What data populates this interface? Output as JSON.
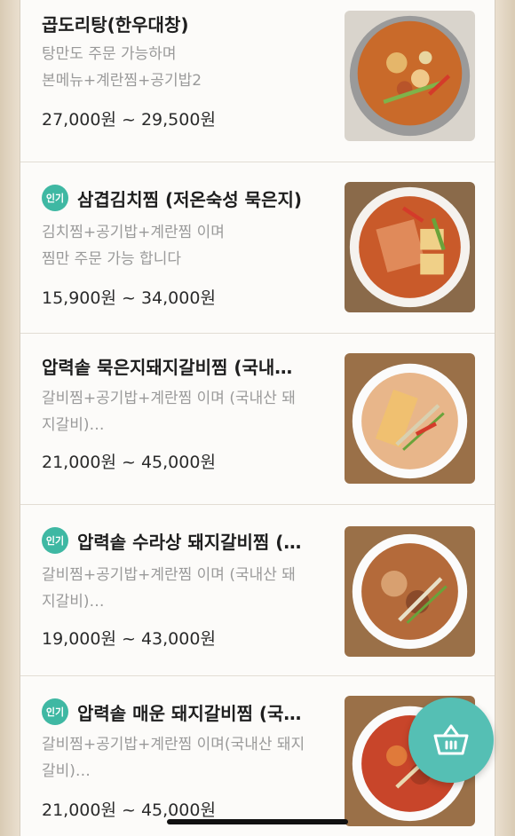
{
  "items": [
    {
      "title": "곱도리탕(한우대창)",
      "badge": "",
      "desc_line1": "탕만도 주문 가능하며",
      "desc_line2": "본메뉴+계란찜+공기밥2",
      "price": "27,000원 ~ 29,500원"
    },
    {
      "title": "삼겹김치찜 (저온숙성 묵은지)",
      "badge": "인기",
      "desc_line1": "김치찜+공기밥+계란찜 이며",
      "desc_line2": "찜만 주문 가능 합니다",
      "price": "15,900원 ~ 34,000원"
    },
    {
      "title": "압력솥 묵은지돼지갈비찜 (국내…",
      "badge": "",
      "desc_line1": "갈비찜+공기밥+계란찜 이며 (국내산 돼",
      "desc_line2": "지갈비)…",
      "price": "21,000원 ~ 45,000원"
    },
    {
      "title": "압력솥 수라상 돼지갈비찜 (…",
      "badge": "인기",
      "desc_line1": "갈비찜+공기밥+계란찜 이며 (국내산 돼",
      "desc_line2": "지갈비)…",
      "price": "19,000원 ~ 43,000원"
    },
    {
      "title": "압력솥 매운 돼지갈비찜 (국…",
      "badge": "인기",
      "desc_line1": "갈비찜+공기밥+계란찜 이며(국내산 돼지",
      "desc_line2": "갈비)…",
      "price": "21,000원 ~ 45,000원"
    }
  ],
  "cart_button": {
    "icon": "basket-icon",
    "color": "#55bfb4"
  },
  "colors": {
    "badge": "#3fb8a3",
    "background": "#fbfaf8"
  }
}
